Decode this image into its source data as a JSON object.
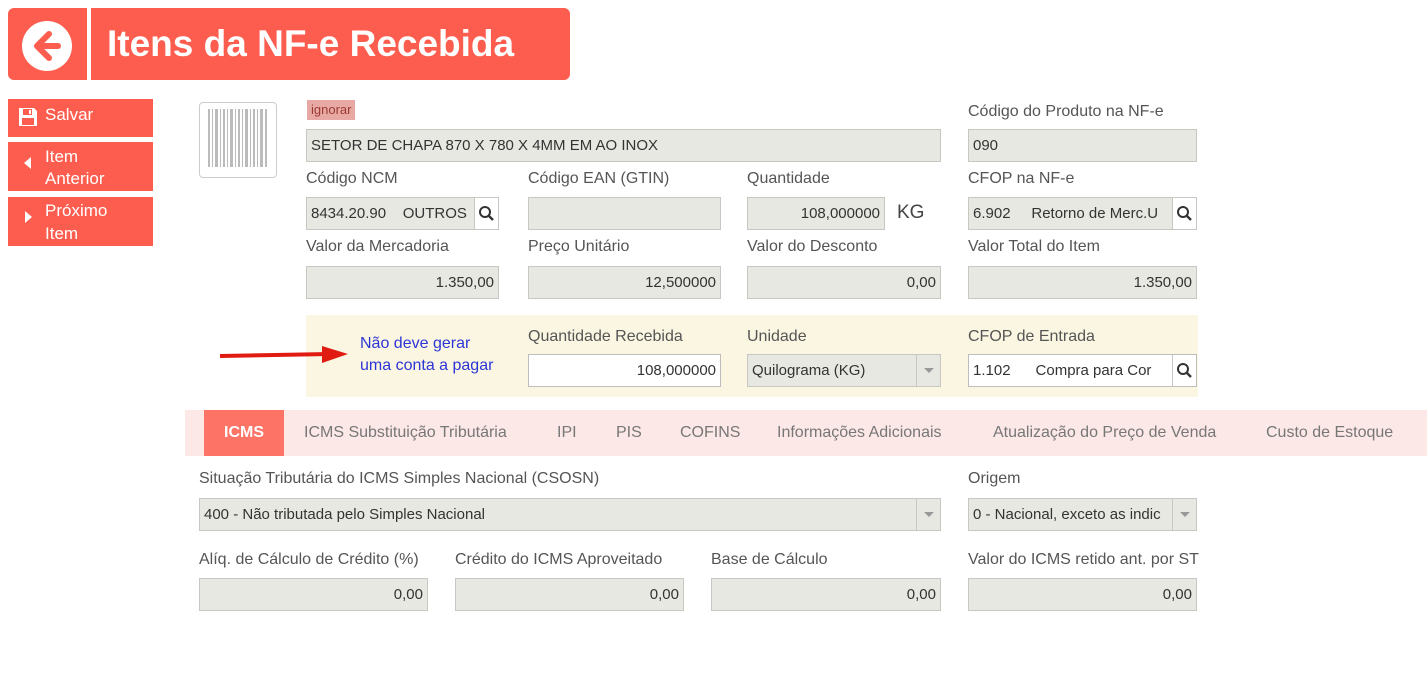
{
  "header": {
    "title": "Itens da NF-e Recebida"
  },
  "sidebar": {
    "save": "Salvar",
    "prev_line1": "Item",
    "prev_line2": "Anterior",
    "next_line1": "Próximo",
    "next_line2": "Item"
  },
  "product": {
    "ignore_badge": "ignorar",
    "description": "SETOR DE CHAPA 870 X 780 X 4MM EM AO INOX",
    "code_label": "Código do Produto na NF-e",
    "code": "090",
    "ncm_label": "Código NCM",
    "ncm_value": "8434.20.90    OUTROS",
    "ean_label": "Código EAN (GTIN)",
    "ean_value": "",
    "qty_label": "Quantidade",
    "qty_value": "108,000000",
    "qty_unit": "KG",
    "cfop_label": "CFOP na NF-e",
    "cfop_value": "6.902     Retorno de Merc.U",
    "merch_label": "Valor da Mercadoria",
    "merch_value": "1.350,00",
    "unit_price_label": "Preço Unitário",
    "unit_price_value": "12,500000",
    "discount_label": "Valor do Desconto",
    "discount_value": "0,00",
    "total_label": "Valor Total do Item",
    "total_value": "1.350,00"
  },
  "receipt": {
    "note_line1": "Não deve gerar",
    "note_line2": "uma conta a pagar",
    "qty_received_label": "Quantidade Recebida",
    "qty_received_value": "108,000000",
    "unit_label": "Unidade",
    "unit_value": "Quilograma (KG)",
    "cfop_in_label": "CFOP de Entrada",
    "cfop_in_value": "1.102      Compra para Cor"
  },
  "tabs": [
    "ICMS",
    "ICMS Substituição Tributária",
    "IPI",
    "PIS",
    "COFINS",
    "Informações Adicionais",
    "Atualização do Preço de Venda",
    "Custo de Estoque"
  ],
  "icms": {
    "csosn_label": "Situação Tributária do ICMS Simples Nacional (CSOSN)",
    "csosn_value": "400 - Não tributada pelo Simples Nacional",
    "origin_label": "Origem",
    "origin_value": "0 - Nacional, exceto as indic",
    "aliq_label": "Alíq. de Cálculo de Crédito (%)",
    "aliq_value": "0,00",
    "credit_label": "Crédito do ICMS Aproveitado",
    "credit_value": "0,00",
    "base_label": "Base de Cálculo",
    "base_value": "0,00",
    "retained_label": "Valor do ICMS retido ant. por ST",
    "retained_value": "0,00"
  },
  "colors": {
    "accent": "#fd5d4e",
    "tab_active": "#fd7366",
    "link": "#2c35d6",
    "arrow": "#e01b12",
    "highlight": "#fbf6e1"
  },
  "icons": [
    "back-arrow-icon",
    "save-icon",
    "chevron-left-icon",
    "chevron-right-icon",
    "barcode-icon",
    "search-icon",
    "dropdown-arrow-icon",
    "red-pointer-arrow-icon"
  ]
}
